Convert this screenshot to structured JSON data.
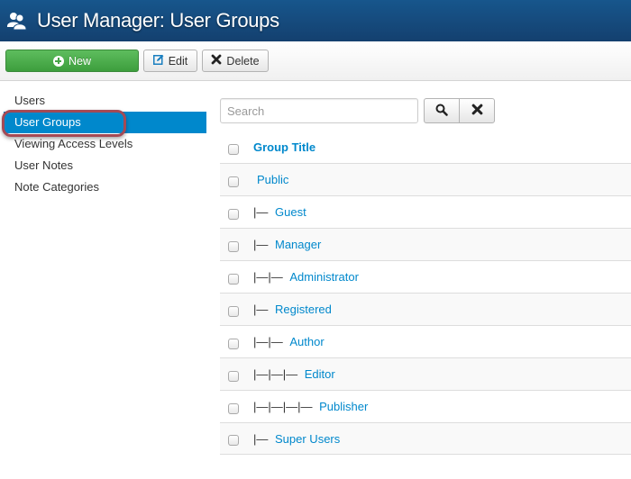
{
  "header": {
    "icon": "users-icon",
    "title": "User Manager: User Groups"
  },
  "toolbar": {
    "new_label": "New",
    "edit_label": "Edit",
    "delete_label": "Delete"
  },
  "sidebar": {
    "items": [
      {
        "label": "Users",
        "active": false
      },
      {
        "label": "User Groups",
        "active": true
      },
      {
        "label": "Viewing Access Levels",
        "active": false
      },
      {
        "label": "User Notes",
        "active": false
      },
      {
        "label": "Note Categories",
        "active": false
      }
    ]
  },
  "search": {
    "placeholder": "Search",
    "value": ""
  },
  "table": {
    "column_header": "Group Title",
    "rows": [
      {
        "prefix": "",
        "title": "Public"
      },
      {
        "prefix": "|— ",
        "title": "Guest"
      },
      {
        "prefix": "|— ",
        "title": "Manager"
      },
      {
        "prefix": "|—|— ",
        "title": "Administrator"
      },
      {
        "prefix": "|— ",
        "title": "Registered"
      },
      {
        "prefix": "|—|— ",
        "title": "Author"
      },
      {
        "prefix": "|—|—|— ",
        "title": "Editor"
      },
      {
        "prefix": "|—|—|—|— ",
        "title": "Publisher"
      },
      {
        "prefix": "|— ",
        "title": "Super Users"
      }
    ]
  },
  "colors": {
    "header_bg": "#14406f",
    "accent": "#0088cc",
    "new_button": "#47a447",
    "annotation": "#a44a55"
  }
}
